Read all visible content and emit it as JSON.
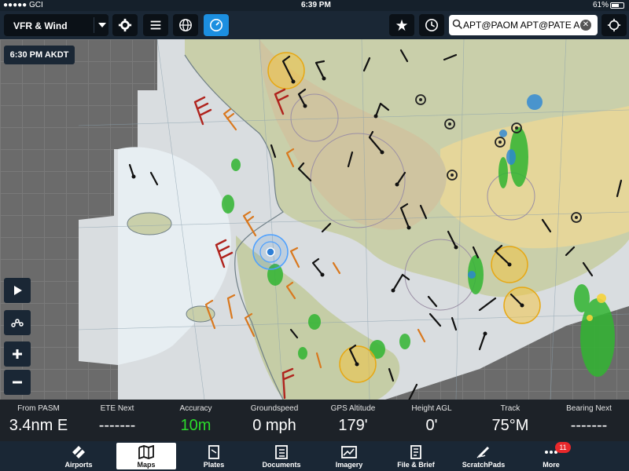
{
  "status_bar": {
    "carrier": "●●●●● GCI",
    "time": "6:39 PM",
    "battery": "61%"
  },
  "toolbar": {
    "layer": "VFR & Wind",
    "search_value": "APT@PAOM APT@PATE A...",
    "buttons": [
      "gear-icon",
      "list-icon",
      "globe-icon",
      "gauge-icon",
      "star-icon",
      "clock-icon",
      "locate-icon"
    ]
  },
  "map": {
    "time_badge": "6:30 PM AKDT",
    "controls": [
      "play-icon",
      "route-icon",
      "zoom-in-icon",
      "zoom-out-icon"
    ]
  },
  "instruments": [
    {
      "label": "From PASM",
      "value": "3.4nm E",
      "color": "#ffffff"
    },
    {
      "label": "ETE Next",
      "value": "-------",
      "color": "#ffffff"
    },
    {
      "label": "Accuracy",
      "value": "10m",
      "color": "#2bdc2b"
    },
    {
      "label": "Groundspeed",
      "value": "0 mph",
      "color": "#ffffff"
    },
    {
      "label": "GPS Altitude",
      "value": "179'",
      "color": "#ffffff"
    },
    {
      "label": "Height AGL",
      "value": "0'",
      "color": "#ffffff"
    },
    {
      "label": "Track",
      "value": "75°M",
      "color": "#ffffff"
    },
    {
      "label": "Bearing Next",
      "value": "-------",
      "color": "#ffffff"
    }
  ],
  "tabs": [
    {
      "label": "Airports",
      "icon": "airports-icon",
      "active": false
    },
    {
      "label": "Maps",
      "icon": "maps-icon",
      "active": true
    },
    {
      "label": "Plates",
      "icon": "plates-icon",
      "active": false
    },
    {
      "label": "Documents",
      "icon": "documents-icon",
      "active": false
    },
    {
      "label": "Imagery",
      "icon": "imagery-icon",
      "active": false
    },
    {
      "label": "File & Brief",
      "icon": "file-brief-icon",
      "active": false
    },
    {
      "label": "ScratchPads",
      "icon": "scratchpads-icon",
      "active": false
    },
    {
      "label": "More",
      "icon": "more-icon",
      "active": false,
      "badge": "11"
    }
  ],
  "colors": {
    "accent": "#1c8fe0",
    "bar": "#1a2735",
    "accuracy_green": "#2bdc2b",
    "badge_red": "#e8282b"
  }
}
